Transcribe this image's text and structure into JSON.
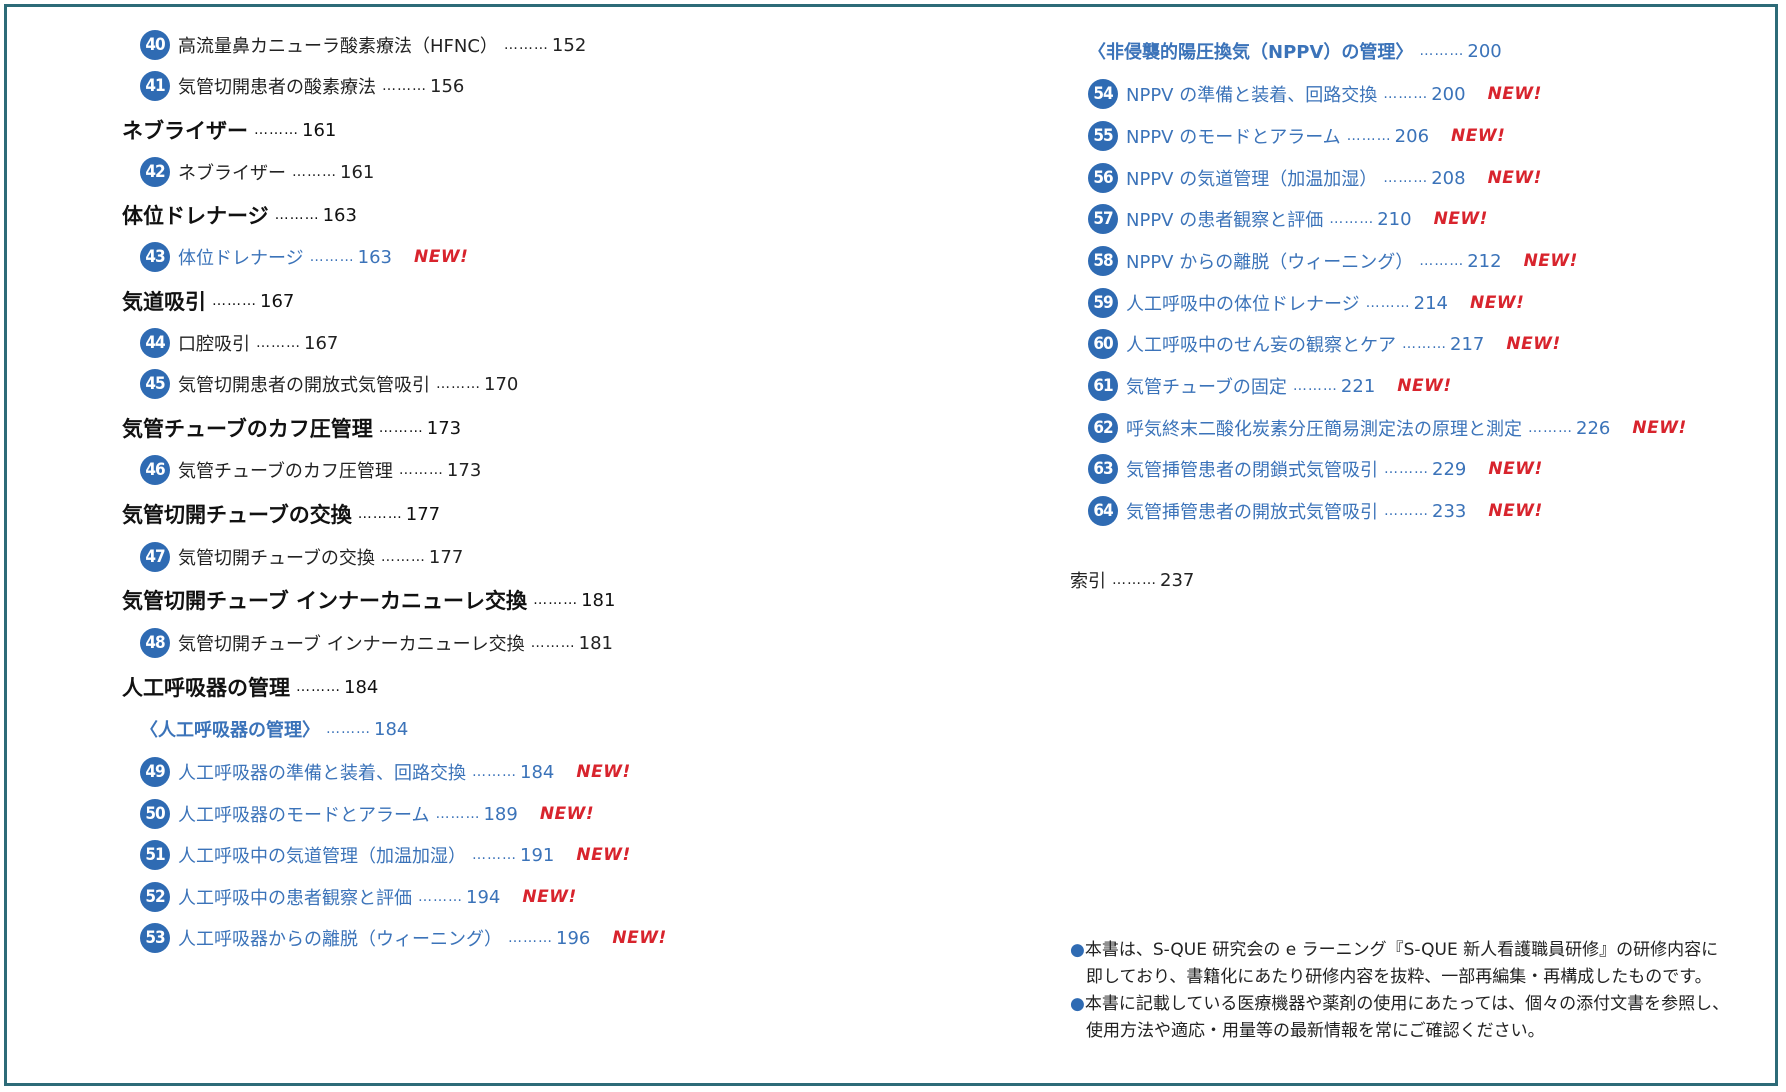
{
  "colors": {
    "accent": "#2f6bb3",
    "link_text": "#3b73b9",
    "new_badge": "#d8242d",
    "border": "#2d6b78"
  },
  "new_label": "NEW!",
  "dots": "………",
  "left_column": [
    {
      "kind": "item",
      "num": "40",
      "text": "高流量鼻カニューラ酸素療法（HFNC）",
      "page": "152",
      "blue": false,
      "new": false
    },
    {
      "kind": "item",
      "num": "41",
      "text": "気管切開患者の酸素療法",
      "page": "156",
      "blue": false,
      "new": false
    },
    {
      "kind": "heading",
      "text": "ネブライザー",
      "page": "161"
    },
    {
      "kind": "item",
      "num": "42",
      "text": "ネブライザー",
      "page": "161",
      "blue": false,
      "new": false
    },
    {
      "kind": "heading",
      "text": "体位ドレナージ",
      "page": "163"
    },
    {
      "kind": "item",
      "num": "43",
      "text": "体位ドレナージ",
      "page": "163",
      "blue": true,
      "new": true
    },
    {
      "kind": "heading",
      "text": "気道吸引",
      "page": "167"
    },
    {
      "kind": "item",
      "num": "44",
      "text": "口腔吸引",
      "page": "167",
      "blue": false,
      "new": false
    },
    {
      "kind": "item",
      "num": "45",
      "text": "気管切開患者の開放式気管吸引",
      "page": "170",
      "blue": false,
      "new": false
    },
    {
      "kind": "heading",
      "text": "気管チューブのカフ圧管理",
      "page": "173"
    },
    {
      "kind": "item",
      "num": "46",
      "text": "気管チューブのカフ圧管理",
      "page": "173",
      "blue": false,
      "new": false
    },
    {
      "kind": "heading",
      "text": "気管切開チューブの交換",
      "page": "177"
    },
    {
      "kind": "item",
      "num": "47",
      "text": "気管切開チューブの交換",
      "page": "177",
      "blue": false,
      "new": false
    },
    {
      "kind": "heading",
      "text": "気管切開チューブ インナーカニューレ交換",
      "page": "181"
    },
    {
      "kind": "item",
      "num": "48",
      "text": "気管切開チューブ インナーカニューレ交換",
      "page": "181",
      "blue": false,
      "new": false
    },
    {
      "kind": "heading",
      "text": "人工呼吸器の管理",
      "page": "184"
    },
    {
      "kind": "sub",
      "text": "〈人工呼吸器の管理〉",
      "page": "184"
    },
    {
      "kind": "item",
      "num": "49",
      "text": "人工呼吸器の準備と装着、回路交換",
      "page": "184",
      "blue": true,
      "new": true
    },
    {
      "kind": "item",
      "num": "50",
      "text": "人工呼吸器のモードとアラーム",
      "page": "189",
      "blue": true,
      "new": true
    },
    {
      "kind": "item",
      "num": "51",
      "text": "人工呼吸中の気道管理（加温加湿）",
      "page": "191",
      "blue": true,
      "new": true
    },
    {
      "kind": "item",
      "num": "52",
      "text": "人工呼吸中の患者観察と評価",
      "page": "194",
      "blue": true,
      "new": true
    },
    {
      "kind": "item",
      "num": "53",
      "text": "人工呼吸器からの離脱（ウィーニング）",
      "page": "196",
      "blue": true,
      "new": true
    }
  ],
  "right_column": [
    {
      "kind": "sub",
      "text": "〈非侵襲的陽圧換気（NPPV）の管理〉",
      "page": "200"
    },
    {
      "kind": "item",
      "num": "54",
      "text": "NPPV の準備と装着、回路交換",
      "page": "200",
      "blue": true,
      "new": true
    },
    {
      "kind": "item",
      "num": "55",
      "text": "NPPV のモードとアラーム",
      "page": "206",
      "blue": true,
      "new": true
    },
    {
      "kind": "item",
      "num": "56",
      "text": "NPPV の気道管理（加温加湿）",
      "page": "208",
      "blue": true,
      "new": true
    },
    {
      "kind": "item",
      "num": "57",
      "text": "NPPV の患者観察と評価",
      "page": "210",
      "blue": true,
      "new": true
    },
    {
      "kind": "item",
      "num": "58",
      "text": "NPPV からの離脱（ウィーニング）",
      "page": "212",
      "blue": true,
      "new": true
    },
    {
      "kind": "item",
      "num": "59",
      "text": "人工呼吸中の体位ドレナージ",
      "page": "214",
      "blue": true,
      "new": true
    },
    {
      "kind": "item",
      "num": "60",
      "text": "人工呼吸中のせん妄の観察とケア",
      "page": "217",
      "blue": true,
      "new": true
    },
    {
      "kind": "item",
      "num": "61",
      "text": "気管チューブの固定",
      "page": "221",
      "blue": true,
      "new": true
    },
    {
      "kind": "item",
      "num": "62",
      "text": "呼気終末二酸化炭素分圧簡易測定法の原理と測定",
      "page": "226",
      "blue": true,
      "new": true
    },
    {
      "kind": "item",
      "num": "63",
      "text": "気管挿管患者の閉鎖式気管吸引",
      "page": "229",
      "blue": true,
      "new": true
    },
    {
      "kind": "item",
      "num": "64",
      "text": "気管挿管患者の開放式気管吸引",
      "page": "233",
      "blue": true,
      "new": true
    },
    {
      "kind": "plain",
      "text": "索引",
      "page": "237"
    }
  ],
  "notes": [
    {
      "bullet": "●",
      "text": "本書は、S-QUE 研究会の e ラーニング『S-QUE 新人看護職員研修』の研修内容に即しており、書籍化にあたり研修内容を抜粋、一部再編集・再構成したものです。"
    },
    {
      "bullet": "●",
      "text": "本書に記載している医療機器や薬剤の使用にあたっては、個々の添付文書を参照し、使用方法や適応・用量等の最新情報を常にご確認ください。"
    }
  ]
}
